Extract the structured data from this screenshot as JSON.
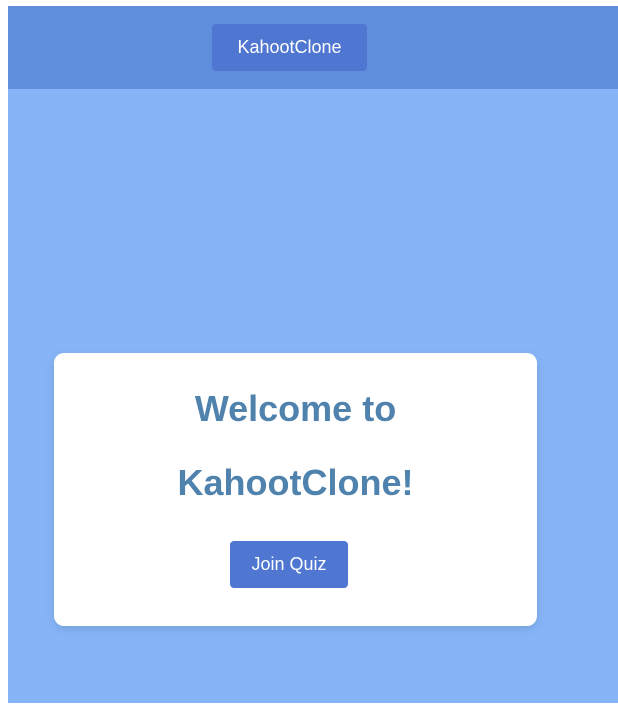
{
  "header": {
    "brand_label": "KahootClone"
  },
  "welcome_card": {
    "title_line1": "Welcome to",
    "title_line2": "KahootClone!",
    "join_button_label": "Join Quiz"
  },
  "colors": {
    "page_background": "#86b5f7",
    "header_background": "#5f8fdc",
    "button_background": "#4f76d0",
    "title_text": "#4f82ac",
    "card_background": "#ffffff"
  }
}
